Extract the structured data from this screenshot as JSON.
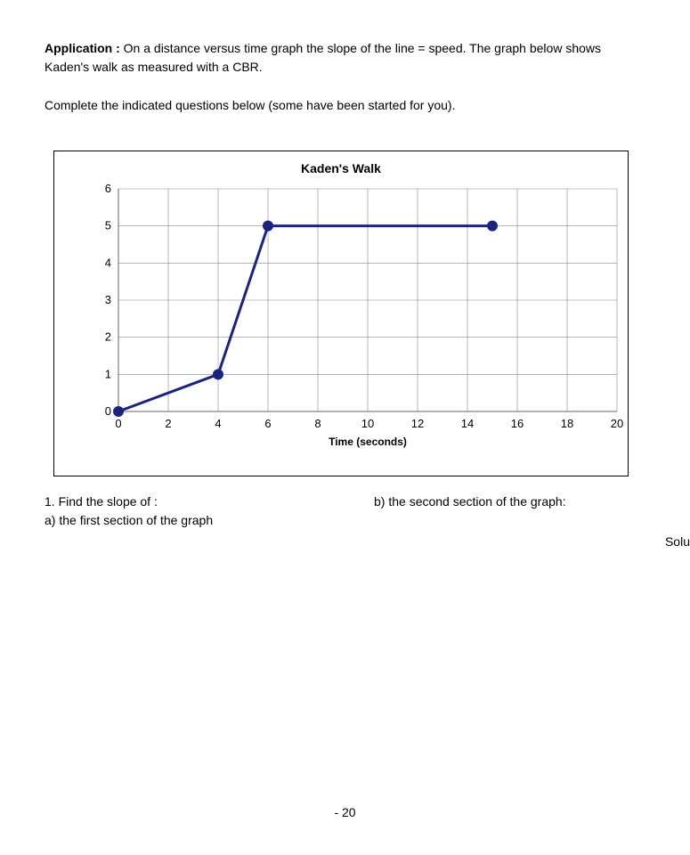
{
  "intro_bold": "Application :",
  "intro_text": " On a distance versus time graph the slope of the line = speed. The graph below shows Kaden's walk as measured with a CBR.",
  "instruction": "Complete the indicated questions below (some have been started for you).",
  "chart_data": {
    "type": "line",
    "title": "Kaden's Walk",
    "xlabel": "Time (seconds)",
    "ylabel": "",
    "xlim": [
      0,
      20
    ],
    "ylim": [
      0,
      6
    ],
    "x_ticks": [
      0,
      2,
      4,
      6,
      8,
      10,
      12,
      14,
      16,
      18,
      20
    ],
    "y_ticks": [
      0,
      1,
      2,
      3,
      4,
      5,
      6
    ],
    "series": [
      {
        "name": "Kaden",
        "x": [
          0,
          4,
          6,
          15
        ],
        "y": [
          0,
          1,
          5,
          5
        ],
        "markers_at": [
          0,
          4,
          6,
          15
        ]
      }
    ]
  },
  "question": {
    "q1_stem": "1. Find the slope of :",
    "q1a": "a)  the first section of the graph",
    "q1b": "b)  the second section of the graph:"
  },
  "page_number": "- 20",
  "side_cut": "Solu"
}
